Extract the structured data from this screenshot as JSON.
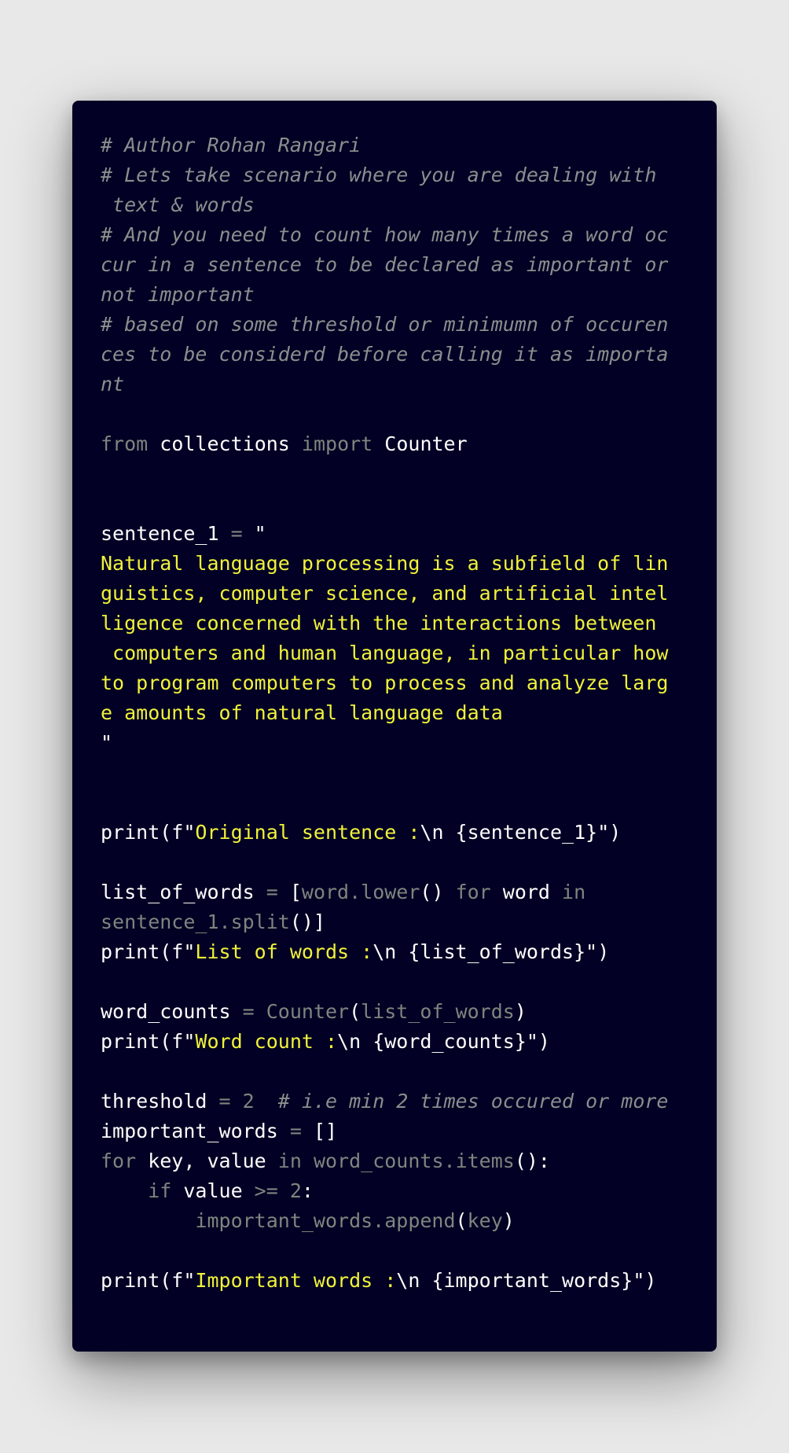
{
  "code": {
    "lines": [
      [
        {
          "t": "# Author Rohan Rangari",
          "k": "comment"
        }
      ],
      [
        {
          "t": "# Lets take scenario where you are dealing with",
          "k": "comment"
        }
      ],
      [
        {
          "t": " text & words",
          "k": "comment"
        }
      ],
      [
        {
          "t": "# And you need to count how many times a word oc",
          "k": "comment"
        }
      ],
      [
        {
          "t": "cur in a sentence to be declared as important or",
          "k": "comment"
        }
      ],
      [
        {
          "t": "not important",
          "k": "comment"
        }
      ],
      [
        {
          "t": "# based on some threshold or minimumn of occuren",
          "k": "comment"
        }
      ],
      [
        {
          "t": "ces to be considerd before calling it as importa",
          "k": "comment"
        }
      ],
      [
        {
          "t": "nt",
          "k": "comment"
        }
      ],
      [],
      [
        {
          "t": "from",
          "k": "keyword"
        },
        {
          "t": " ",
          "k": "name"
        },
        {
          "t": "collections",
          "k": "name"
        },
        {
          "t": " ",
          "k": "name"
        },
        {
          "t": "import",
          "k": "keyword"
        },
        {
          "t": " ",
          "k": "name"
        },
        {
          "t": "Counter",
          "k": "name"
        }
      ],
      [],
      [],
      [
        {
          "t": "sentence_1",
          "k": "name"
        },
        {
          "t": " = ",
          "k": "op"
        },
        {
          "t": "\"",
          "k": "punct"
        }
      ],
      [
        {
          "t": "Natural language processing is a subfield of lin",
          "k": "string"
        }
      ],
      [
        {
          "t": "guistics, computer science, and artificial intel",
          "k": "string"
        }
      ],
      [
        {
          "t": "ligence concerned with the interactions between",
          "k": "string"
        }
      ],
      [
        {
          "t": " computers and human language, in particular how",
          "k": "string"
        }
      ],
      [
        {
          "t": "to program computers to process and analyze larg",
          "k": "string"
        }
      ],
      [
        {
          "t": "e amounts of natural language data",
          "k": "string"
        }
      ],
      [
        {
          "t": "\"",
          "k": "punct"
        }
      ],
      [],
      [],
      [
        {
          "t": "print(f\"",
          "k": "name"
        },
        {
          "t": "Original sentence :",
          "k": "string"
        },
        {
          "t": "\\n {sentence_1}",
          "k": "escape"
        },
        {
          "t": "\")",
          "k": "name"
        }
      ],
      [],
      [
        {
          "t": "list_of_words",
          "k": "name"
        },
        {
          "t": " = ",
          "k": "op"
        },
        {
          "t": "[",
          "k": "punct"
        },
        {
          "t": "word.lower",
          "k": "attr"
        },
        {
          "t": "()",
          "k": "punct"
        },
        {
          "t": " for ",
          "k": "keyword"
        },
        {
          "t": "word",
          "k": "name"
        },
        {
          "t": " in",
          "k": "keyword"
        }
      ],
      [
        {
          "t": "sentence_1.split",
          "k": "attr"
        },
        {
          "t": "()]",
          "k": "punct"
        }
      ],
      [
        {
          "t": "print(f\"",
          "k": "name"
        },
        {
          "t": "List of words :",
          "k": "string"
        },
        {
          "t": "\\n {list_of_words}",
          "k": "escape"
        },
        {
          "t": "\")",
          "k": "name"
        }
      ],
      [],
      [
        {
          "t": "word_counts",
          "k": "name"
        },
        {
          "t": " = ",
          "k": "op"
        },
        {
          "t": "Counter",
          "k": "attr"
        },
        {
          "t": "(",
          "k": "punct"
        },
        {
          "t": "list_of_words",
          "k": "attr"
        },
        {
          "t": ")",
          "k": "punct"
        }
      ],
      [
        {
          "t": "print(f\"",
          "k": "name"
        },
        {
          "t": "Word count :",
          "k": "string"
        },
        {
          "t": "\\n {word_counts}",
          "k": "escape"
        },
        {
          "t": "\")",
          "k": "name"
        }
      ],
      [],
      [
        {
          "t": "threshold",
          "k": "name"
        },
        {
          "t": " = ",
          "k": "op"
        },
        {
          "t": "2",
          "k": "number"
        },
        {
          "t": "  # i.e min 2 times occured or more",
          "k": "comment"
        }
      ],
      [
        {
          "t": "important_words",
          "k": "name"
        },
        {
          "t": " = ",
          "k": "op"
        },
        {
          "t": "[]",
          "k": "punct"
        }
      ],
      [
        {
          "t": "for",
          "k": "keyword"
        },
        {
          "t": " key, value",
          "k": "name"
        },
        {
          "t": " in ",
          "k": "keyword"
        },
        {
          "t": "word_counts.items",
          "k": "attr"
        },
        {
          "t": "():",
          "k": "punct"
        }
      ],
      [
        {
          "t": "    if",
          "k": "keyword"
        },
        {
          "t": " value",
          "k": "name"
        },
        {
          "t": " >= ",
          "k": "op"
        },
        {
          "t": "2",
          "k": "number"
        },
        {
          "t": ":",
          "k": "punct"
        }
      ],
      [
        {
          "t": "        important_words.append",
          "k": "attr"
        },
        {
          "t": "(",
          "k": "punct"
        },
        {
          "t": "key",
          "k": "attr"
        },
        {
          "t": ")",
          "k": "punct"
        }
      ],
      [],
      [
        {
          "t": "print(f\"",
          "k": "name"
        },
        {
          "t": "Important words :",
          "k": "string"
        },
        {
          "t": "\\n {important_words}",
          "k": "escape"
        },
        {
          "t": "\")",
          "k": "name"
        }
      ]
    ]
  },
  "colors": {
    "page_background": "#e8e8e8",
    "card_background": "#020024",
    "comment": "#8b8f8e",
    "keyword": "#7e857f",
    "name": "#ffffff",
    "string": "#f0f23b"
  }
}
